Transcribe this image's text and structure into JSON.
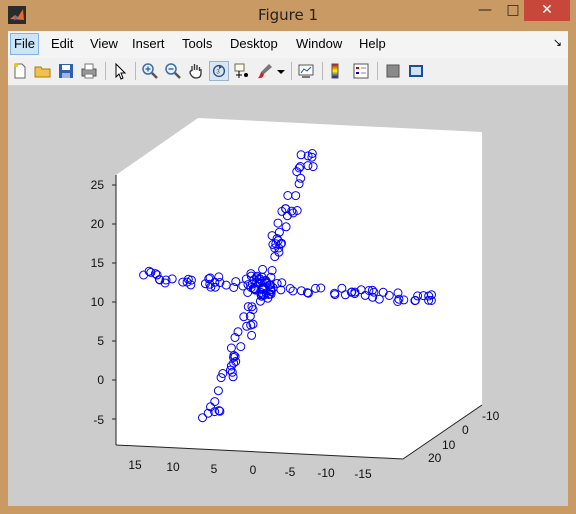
{
  "window": {
    "title": "Figure 1",
    "minimize_glyph": "—",
    "maximize_glyph": "□",
    "close_glyph": "✕"
  },
  "menubar": {
    "items": [
      "File",
      "Edit",
      "View",
      "Insert",
      "Tools",
      "Desktop",
      "Window",
      "Help"
    ],
    "corner_glyph": "↘"
  },
  "toolbar": {
    "buttons": [
      "new-figure",
      "open-file",
      "save-figure",
      "print-figure",
      "edit-plot-pointer",
      "zoom-in",
      "zoom-out",
      "pan",
      "rotate-3d",
      "data-cursor",
      "brush",
      "brush-dropdown",
      "link-plot",
      "insert-colorbar",
      "insert-legend",
      "hide-plot-tools",
      "show-plot-tools"
    ],
    "pressed": "rotate-3d"
  },
  "plot": {
    "background": "#cccccc",
    "axes_face": "#ffffff",
    "marker_color": "#0000ff"
  },
  "chart_data": {
    "type": "scatter",
    "projection": "3d",
    "marker": "open-circle",
    "color": "#0000ff",
    "title": "",
    "xlabel": "",
    "ylabel": "",
    "zlabel": "",
    "axes": {
      "x": {
        "ticks": [
          15,
          10,
          5,
          0,
          -5,
          -10,
          -15
        ]
      },
      "y": {
        "ticks": [
          20,
          10,
          0,
          -10
        ]
      },
      "z": {
        "ticks": [
          25,
          20,
          15,
          10,
          5,
          0,
          -5
        ]
      }
    },
    "point_groups": [
      {
        "name": "",
        "x": [
          -7,
          0,
          7
        ],
        "y": [
          0,
          0,
          0
        ],
        "z": [
          10,
          10,
          10
        ]
      }
    ]
  }
}
